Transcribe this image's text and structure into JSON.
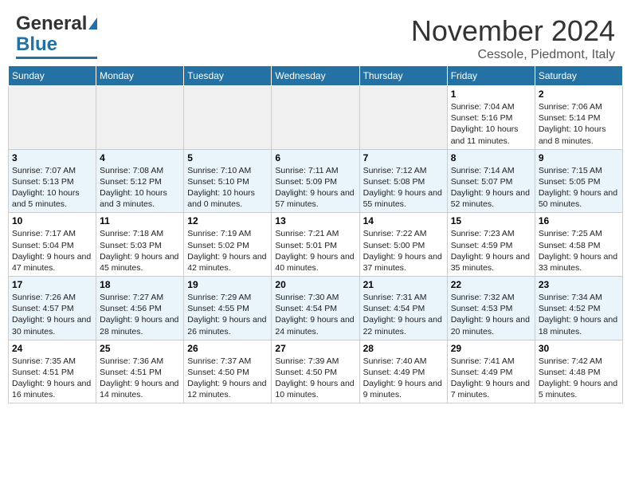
{
  "header": {
    "logo_general": "General",
    "logo_blue": "Blue",
    "month": "November 2024",
    "location": "Cessole, Piedmont, Italy"
  },
  "weekdays": [
    "Sunday",
    "Monday",
    "Tuesday",
    "Wednesday",
    "Thursday",
    "Friday",
    "Saturday"
  ],
  "weeks": [
    {
      "row_class": "row-odd",
      "days": [
        {
          "num": "",
          "empty": true
        },
        {
          "num": "",
          "empty": true
        },
        {
          "num": "",
          "empty": true
        },
        {
          "num": "",
          "empty": true
        },
        {
          "num": "",
          "empty": true
        },
        {
          "num": "1",
          "empty": false,
          "sunrise": "7:04 AM",
          "sunset": "5:16 PM",
          "daylight": "10 hours and 11 minutes."
        },
        {
          "num": "2",
          "empty": false,
          "sunrise": "7:06 AM",
          "sunset": "5:14 PM",
          "daylight": "10 hours and 8 minutes."
        }
      ]
    },
    {
      "row_class": "row-even",
      "days": [
        {
          "num": "3",
          "empty": false,
          "sunrise": "7:07 AM",
          "sunset": "5:13 PM",
          "daylight": "10 hours and 5 minutes."
        },
        {
          "num": "4",
          "empty": false,
          "sunrise": "7:08 AM",
          "sunset": "5:12 PM",
          "daylight": "10 hours and 3 minutes."
        },
        {
          "num": "5",
          "empty": false,
          "sunrise": "7:10 AM",
          "sunset": "5:10 PM",
          "daylight": "10 hours and 0 minutes."
        },
        {
          "num": "6",
          "empty": false,
          "sunrise": "7:11 AM",
          "sunset": "5:09 PM",
          "daylight": "9 hours and 57 minutes."
        },
        {
          "num": "7",
          "empty": false,
          "sunrise": "7:12 AM",
          "sunset": "5:08 PM",
          "daylight": "9 hours and 55 minutes."
        },
        {
          "num": "8",
          "empty": false,
          "sunrise": "7:14 AM",
          "sunset": "5:07 PM",
          "daylight": "9 hours and 52 minutes."
        },
        {
          "num": "9",
          "empty": false,
          "sunrise": "7:15 AM",
          "sunset": "5:05 PM",
          "daylight": "9 hours and 50 minutes."
        }
      ]
    },
    {
      "row_class": "row-odd",
      "days": [
        {
          "num": "10",
          "empty": false,
          "sunrise": "7:17 AM",
          "sunset": "5:04 PM",
          "daylight": "9 hours and 47 minutes."
        },
        {
          "num": "11",
          "empty": false,
          "sunrise": "7:18 AM",
          "sunset": "5:03 PM",
          "daylight": "9 hours and 45 minutes."
        },
        {
          "num": "12",
          "empty": false,
          "sunrise": "7:19 AM",
          "sunset": "5:02 PM",
          "daylight": "9 hours and 42 minutes."
        },
        {
          "num": "13",
          "empty": false,
          "sunrise": "7:21 AM",
          "sunset": "5:01 PM",
          "daylight": "9 hours and 40 minutes."
        },
        {
          "num": "14",
          "empty": false,
          "sunrise": "7:22 AM",
          "sunset": "5:00 PM",
          "daylight": "9 hours and 37 minutes."
        },
        {
          "num": "15",
          "empty": false,
          "sunrise": "7:23 AM",
          "sunset": "4:59 PM",
          "daylight": "9 hours and 35 minutes."
        },
        {
          "num": "16",
          "empty": false,
          "sunrise": "7:25 AM",
          "sunset": "4:58 PM",
          "daylight": "9 hours and 33 minutes."
        }
      ]
    },
    {
      "row_class": "row-even",
      "days": [
        {
          "num": "17",
          "empty": false,
          "sunrise": "7:26 AM",
          "sunset": "4:57 PM",
          "daylight": "9 hours and 30 minutes."
        },
        {
          "num": "18",
          "empty": false,
          "sunrise": "7:27 AM",
          "sunset": "4:56 PM",
          "daylight": "9 hours and 28 minutes."
        },
        {
          "num": "19",
          "empty": false,
          "sunrise": "7:29 AM",
          "sunset": "4:55 PM",
          "daylight": "9 hours and 26 minutes."
        },
        {
          "num": "20",
          "empty": false,
          "sunrise": "7:30 AM",
          "sunset": "4:54 PM",
          "daylight": "9 hours and 24 minutes."
        },
        {
          "num": "21",
          "empty": false,
          "sunrise": "7:31 AM",
          "sunset": "4:54 PM",
          "daylight": "9 hours and 22 minutes."
        },
        {
          "num": "22",
          "empty": false,
          "sunrise": "7:32 AM",
          "sunset": "4:53 PM",
          "daylight": "9 hours and 20 minutes."
        },
        {
          "num": "23",
          "empty": false,
          "sunrise": "7:34 AM",
          "sunset": "4:52 PM",
          "daylight": "9 hours and 18 minutes."
        }
      ]
    },
    {
      "row_class": "row-odd",
      "days": [
        {
          "num": "24",
          "empty": false,
          "sunrise": "7:35 AM",
          "sunset": "4:51 PM",
          "daylight": "9 hours and 16 minutes."
        },
        {
          "num": "25",
          "empty": false,
          "sunrise": "7:36 AM",
          "sunset": "4:51 PM",
          "daylight": "9 hours and 14 minutes."
        },
        {
          "num": "26",
          "empty": false,
          "sunrise": "7:37 AM",
          "sunset": "4:50 PM",
          "daylight": "9 hours and 12 minutes."
        },
        {
          "num": "27",
          "empty": false,
          "sunrise": "7:39 AM",
          "sunset": "4:50 PM",
          "daylight": "9 hours and 10 minutes."
        },
        {
          "num": "28",
          "empty": false,
          "sunrise": "7:40 AM",
          "sunset": "4:49 PM",
          "daylight": "9 hours and 9 minutes."
        },
        {
          "num": "29",
          "empty": false,
          "sunrise": "7:41 AM",
          "sunset": "4:49 PM",
          "daylight": "9 hours and 7 minutes."
        },
        {
          "num": "30",
          "empty": false,
          "sunrise": "7:42 AM",
          "sunset": "4:48 PM",
          "daylight": "9 hours and 5 minutes."
        }
      ]
    }
  ]
}
